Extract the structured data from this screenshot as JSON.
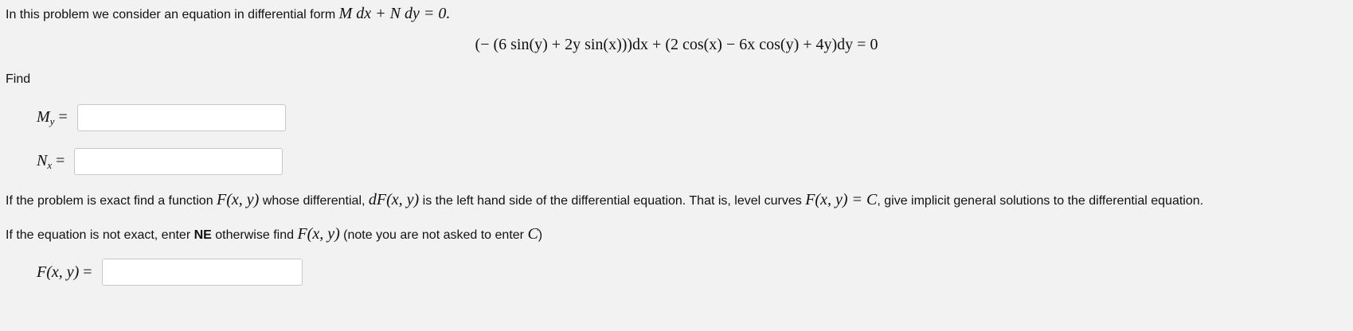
{
  "intro": {
    "text": "In this problem we consider an equation in differential form ",
    "math": "M dx + N dy = 0."
  },
  "equation": {
    "text": "(− (6 sin(y) + 2y sin(x)))dx + (2 cos(x) − 6x cos(y) + 4y)dy = 0"
  },
  "find_label": "Find",
  "fields": {
    "my": {
      "label_main": "M",
      "label_sub": "y",
      "equals": "=",
      "value": "",
      "placeholder": ""
    },
    "nx": {
      "label_main": "N",
      "label_sub": "x",
      "equals": "=",
      "value": "",
      "placeholder": ""
    },
    "f": {
      "label": "F(x, y)",
      "equals": "=",
      "value": "",
      "placeholder": ""
    }
  },
  "exact_paragraph": {
    "part1": "If the problem is exact find a function ",
    "math1": "F(x, y)",
    "part2": " whose differential, ",
    "math2": "dF(x, y)",
    "part3": " is the left hand side of the differential equation. That is, level curves ",
    "math3": "F(x, y) = C",
    "part4": ", give implicit general solutions to the differential equation."
  },
  "not_exact_paragraph": {
    "part1": "If the equation is not exact, enter ",
    "bold": "NE",
    "part2": " otherwise find ",
    "math1": "F(x, y)",
    "part3": " (note you are not asked to enter ",
    "math2": "C",
    "part4": ")"
  }
}
